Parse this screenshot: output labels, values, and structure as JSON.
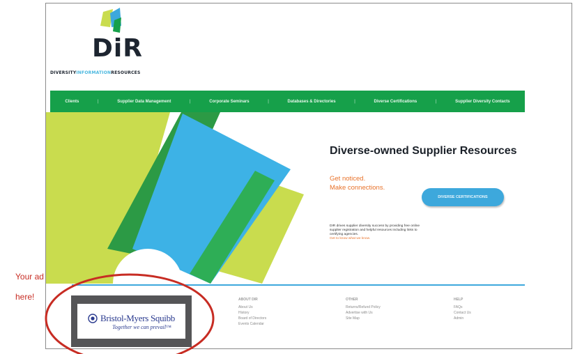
{
  "logo": {
    "text": "DiR",
    "tagline_parts": [
      "DIVERSITY",
      "INFORMATION",
      "RESOURCES"
    ]
  },
  "nav": {
    "items": [
      "Clients",
      "Supplier Data Management",
      "Corporate Seminars",
      "Databases & Directories",
      "Diverse Certifications",
      "Supplier Diversity Contacts"
    ],
    "separator": "|"
  },
  "hero": {
    "headline": "Diverse-owned Supplier Resources",
    "sub_lines": [
      "Get noticed.",
      "Make connections."
    ],
    "cta": "DIVERSE CERTIFICATIONS",
    "body": "DIR drives supplier diversity success by providing free online supplier registration and helpful resources including links to certifying agencies.",
    "body_link": "Get to know what we know."
  },
  "ad": {
    "brand": "Bristol-Myers Squibb",
    "slogan": "Together we can prevail™"
  },
  "footer": {
    "columns": [
      {
        "heading": "ABOUT DIR",
        "links": [
          "About Us",
          "History",
          "Board of Directors",
          "Events Calendar"
        ]
      },
      {
        "heading": "OTHER",
        "links": [
          "Returns/Refund Policy",
          "Advertise with Us",
          "Site Map"
        ]
      },
      {
        "heading": "HELP",
        "links": [
          "FAQs",
          "Contact Us",
          "Admin"
        ]
      }
    ]
  },
  "annotation": {
    "lines": [
      "Your ad",
      "here!"
    ]
  },
  "colors": {
    "green": "#16a04a",
    "blue": "#3da8dc",
    "lime": "#c9dc4e",
    "orange": "#e8722a",
    "annotation_red": "#c72c23"
  }
}
